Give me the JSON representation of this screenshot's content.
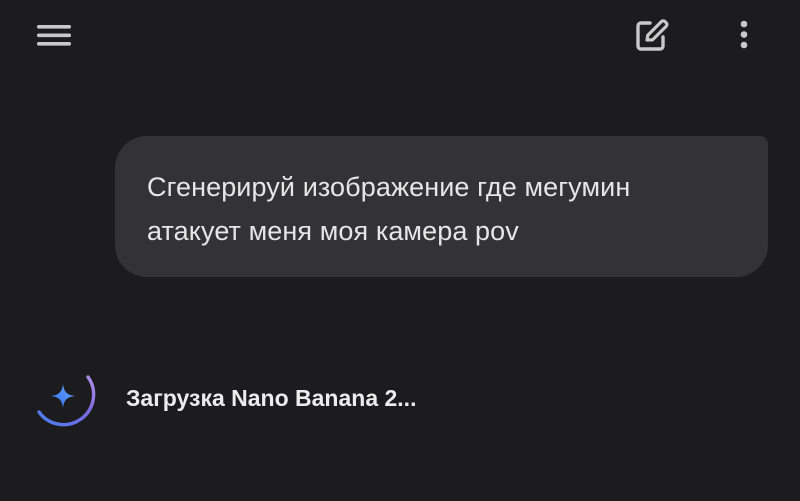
{
  "header": {
    "menu_icon": "hamburger-menu-icon",
    "new_chat_icon": "edit-square-icon",
    "more_icon": "more-vertical-icon"
  },
  "conversation": {
    "user_message": {
      "line1": "Сгенерируй изображение где мегумин",
      "line2": "атакует меня моя камера pov"
    },
    "assistant": {
      "status_icon": "gemini-spark-icon",
      "status_text": "Загрузка Nano Banana 2..."
    }
  },
  "colors": {
    "background": "#1c1c1e",
    "bubble": "#333335",
    "text": "#e3e3e3",
    "spark_blue": "#4a86f7",
    "ring_purple": "#8a6ad6"
  }
}
